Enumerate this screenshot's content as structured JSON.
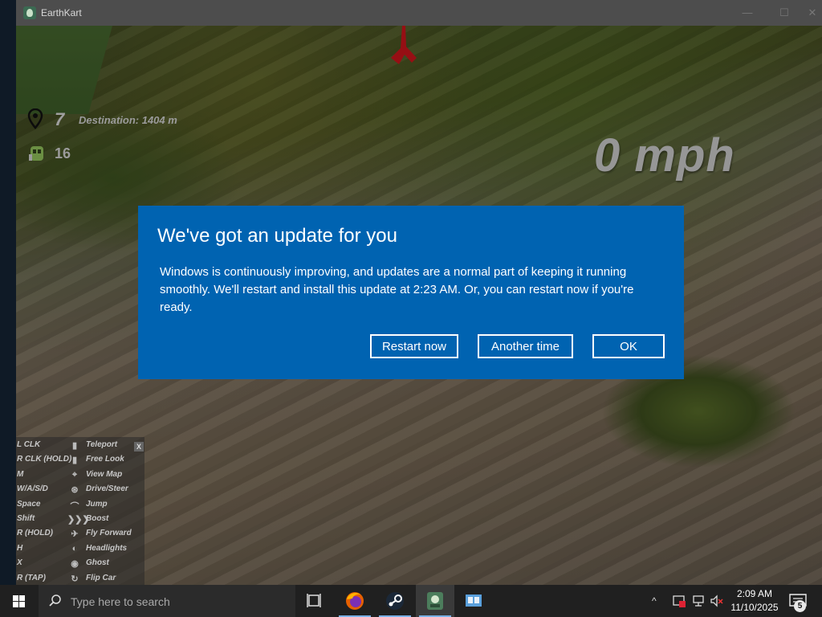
{
  "window": {
    "title": "EarthKart",
    "minimize_glyph": "—",
    "maximize_glyph": "☐",
    "close_glyph": "✕"
  },
  "hud": {
    "pin_count": "7",
    "destination": "Destination: 1404 m",
    "ghost_count": "16",
    "speed": "0 mph"
  },
  "controls": {
    "close_label": "X",
    "rows": [
      {
        "key": "L CLK",
        "icon": "mouse-left-icon",
        "glyph": "▮",
        "action": "Teleport"
      },
      {
        "key": "R CLK (HOLD)",
        "icon": "mouse-right-icon",
        "glyph": "▮",
        "action": "Free Look"
      },
      {
        "key": "M",
        "icon": "map-icon",
        "glyph": "⌖",
        "action": "View Map"
      },
      {
        "key": "W/A/S/D",
        "icon": "steering-wheel-icon",
        "glyph": "⊛",
        "action": "Drive/Steer"
      },
      {
        "key": "Space",
        "icon": "jump-icon",
        "glyph": "⌒",
        "action": "Jump"
      },
      {
        "key": "Shift",
        "icon": "boost-icon",
        "glyph": "❯❯❯",
        "action": "Boost"
      },
      {
        "key": "R (HOLD)",
        "icon": "fly-forward-icon",
        "glyph": "✈",
        "action": "Fly Forward"
      },
      {
        "key": "H",
        "icon": "headlights-icon",
        "glyph": "◐",
        "action": "Headlights"
      },
      {
        "key": "X",
        "icon": "ghost-icon",
        "glyph": "◉",
        "action": "Ghost"
      },
      {
        "key": "R (TAP)",
        "icon": "flip-car-icon",
        "glyph": "↻",
        "action": "Flip Car"
      }
    ]
  },
  "dialog": {
    "title": "We've got an update for you",
    "body": "Windows is continuously improving, and updates are a normal part of keeping it running smoothly. We'll restart and install this update at 2:23 AM. Or, you can restart now if you're ready.",
    "restart_label": "Restart now",
    "another_label": "Another time",
    "ok_label": "OK",
    "color": "#0063b1"
  },
  "taskbar": {
    "search_placeholder": "Type here to search",
    "pinned": [
      "task-view-icon",
      "firefox-icon",
      "steam-icon",
      "earthkart-icon",
      "file-explorer-icon"
    ],
    "tray_chevron": "^",
    "time": "2:09 AM",
    "date": "11/10/2025",
    "notification_count": "5"
  }
}
